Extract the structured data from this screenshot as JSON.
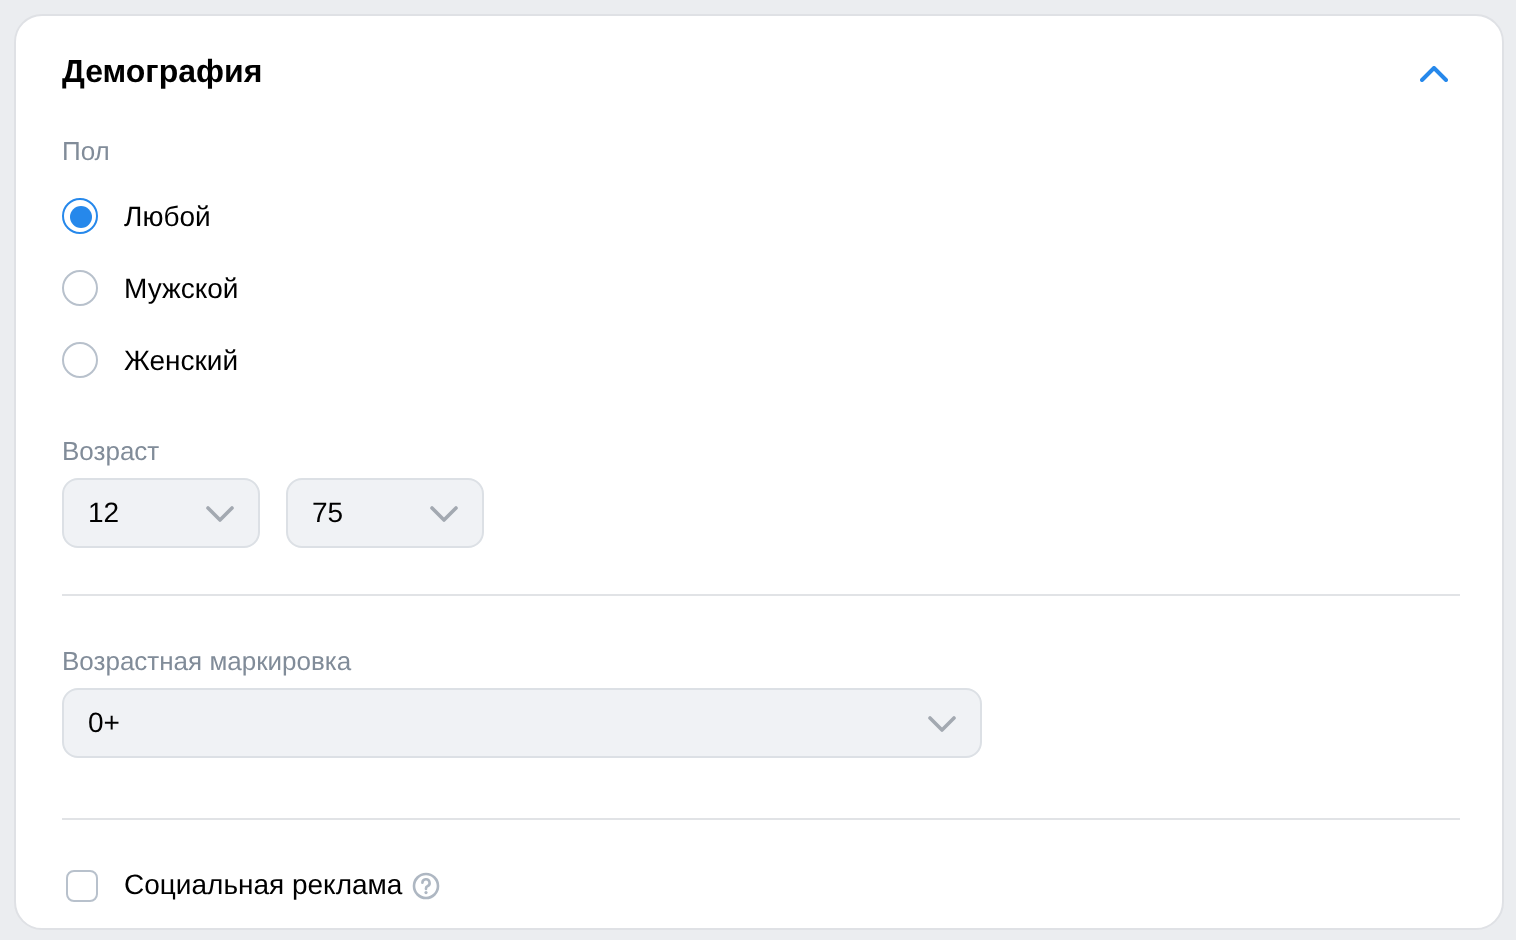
{
  "section": {
    "title": "Демография",
    "expanded": true
  },
  "gender": {
    "label": "Пол",
    "options": [
      {
        "label": "Любой",
        "selected": true
      },
      {
        "label": "Мужской",
        "selected": false
      },
      {
        "label": "Женский",
        "selected": false
      }
    ]
  },
  "age": {
    "label": "Возраст",
    "from": "12",
    "to": "75"
  },
  "age_rating": {
    "label": "Возрастная маркировка",
    "value": "0+"
  },
  "social_ad": {
    "label": "Социальная реклама",
    "checked": false
  }
}
